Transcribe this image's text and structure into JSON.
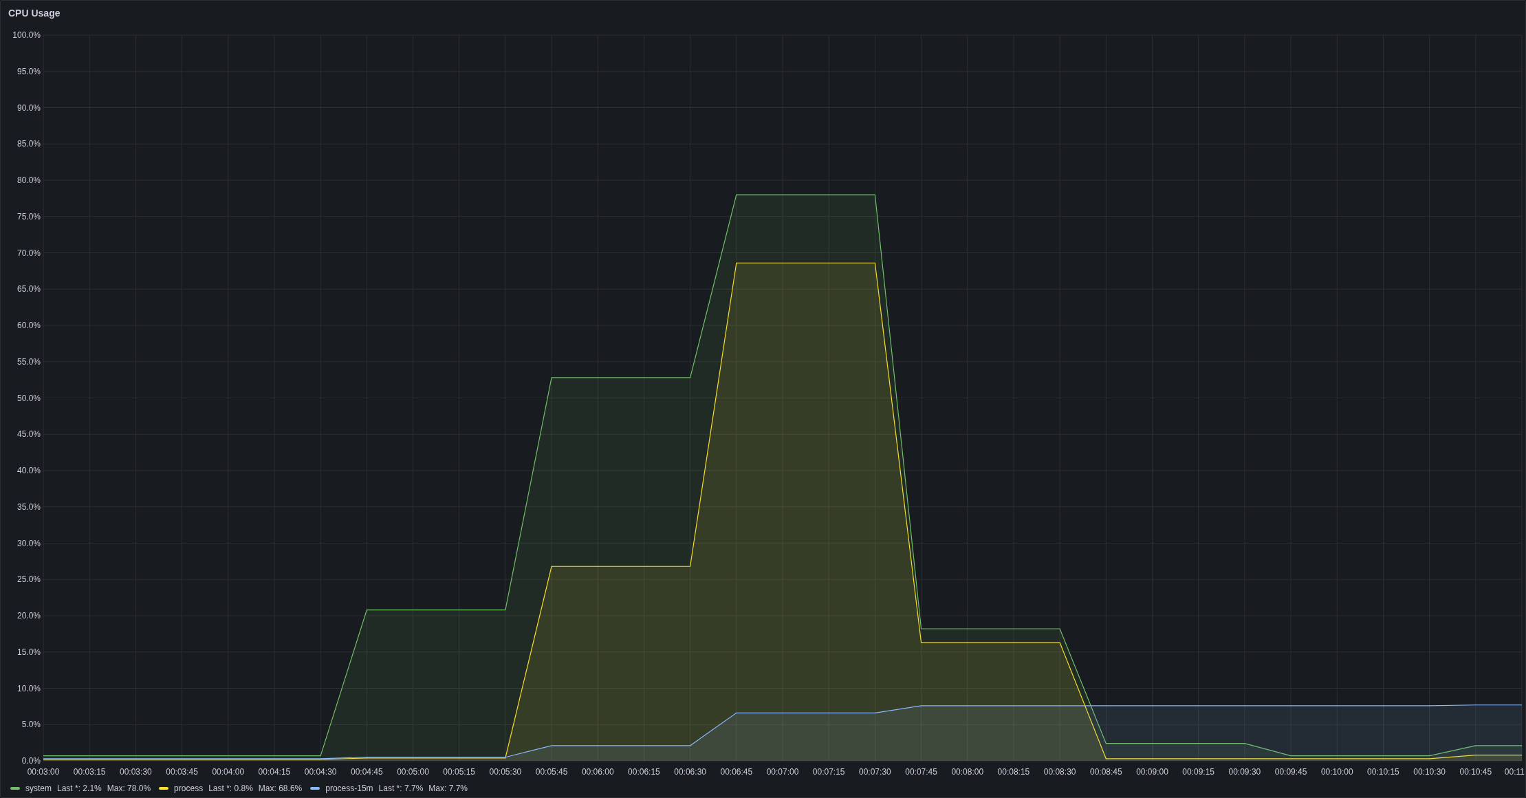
{
  "panel": {
    "title": "CPU Usage"
  },
  "chart_data": {
    "type": "area",
    "grid": true,
    "categories": [
      "00:03:00",
      "00:03:15",
      "00:03:30",
      "00:03:45",
      "00:04:00",
      "00:04:15",
      "00:04:30",
      "00:04:45",
      "00:05:00",
      "00:05:15",
      "00:05:30",
      "00:05:45",
      "00:06:00",
      "00:06:15",
      "00:06:30",
      "00:06:45",
      "00:07:00",
      "00:07:15",
      "00:07:30",
      "00:07:45",
      "00:08:00",
      "00:08:15",
      "00:08:30",
      "00:08:45",
      "00:09:00",
      "00:09:15",
      "00:09:30",
      "00:09:45",
      "00:10:00",
      "00:10:15",
      "00:10:30",
      "00:10:45",
      "00:11"
    ],
    "ylim": [
      0,
      100
    ],
    "yticks": [
      {
        "value": 0,
        "label": "0.0%"
      },
      {
        "value": 5,
        "label": "5.0%"
      },
      {
        "value": 10,
        "label": "10.0%"
      },
      {
        "value": 15,
        "label": "15.0%"
      },
      {
        "value": 20,
        "label": "20.0%"
      },
      {
        "value": 25,
        "label": "25.0%"
      },
      {
        "value": 30,
        "label": "30.0%"
      },
      {
        "value": 35,
        "label": "35.0%"
      },
      {
        "value": 40,
        "label": "40.0%"
      },
      {
        "value": 45,
        "label": "45.0%"
      },
      {
        "value": 50,
        "label": "50.0%"
      },
      {
        "value": 55,
        "label": "55.0%"
      },
      {
        "value": 60,
        "label": "60.0%"
      },
      {
        "value": 65,
        "label": "65.0%"
      },
      {
        "value": 70,
        "label": "70.0%"
      },
      {
        "value": 75,
        "label": "75.0%"
      },
      {
        "value": 80,
        "label": "80.0%"
      },
      {
        "value": 85,
        "label": "85.0%"
      },
      {
        "value": 90,
        "label": "90.0%"
      },
      {
        "value": 95,
        "label": "95.0%"
      },
      {
        "value": 100,
        "label": "100.0%"
      }
    ],
    "series": [
      {
        "name": "system",
        "color": "#73bf69",
        "values": [
          0.7,
          0.7,
          0.7,
          0.7,
          0.7,
          0.7,
          0.7,
          20.8,
          20.8,
          20.8,
          20.8,
          52.8,
          52.8,
          52.8,
          52.8,
          78.0,
          78.0,
          78.0,
          78.0,
          18.2,
          18.2,
          18.2,
          18.2,
          2.4,
          2.4,
          2.4,
          2.4,
          0.7,
          0.7,
          0.7,
          0.7,
          2.1,
          2.1
        ]
      },
      {
        "name": "process",
        "color": "#fade2a",
        "values": [
          0.2,
          0.2,
          0.2,
          0.2,
          0.2,
          0.2,
          0.2,
          0.4,
          0.4,
          0.4,
          0.4,
          26.8,
          26.8,
          26.8,
          26.8,
          68.6,
          68.6,
          68.6,
          68.6,
          16.3,
          16.3,
          16.3,
          16.3,
          0.3,
          0.3,
          0.3,
          0.3,
          0.3,
          0.3,
          0.3,
          0.3,
          0.8,
          0.8
        ]
      },
      {
        "name": "process-15m",
        "color": "#8ab8ff",
        "values": [
          0.3,
          0.3,
          0.3,
          0.3,
          0.3,
          0.3,
          0.3,
          0.5,
          0.5,
          0.5,
          0.5,
          2.1,
          2.1,
          2.1,
          2.1,
          6.6,
          6.6,
          6.6,
          6.6,
          7.6,
          7.6,
          7.6,
          7.6,
          7.6,
          7.6,
          7.6,
          7.6,
          7.6,
          7.6,
          7.6,
          7.6,
          7.7,
          7.7
        ]
      }
    ]
  },
  "legend": [
    {
      "last": "Last *: 2.1%",
      "max": "Max: 78.0%"
    },
    {
      "last": "Last *: 0.8%",
      "max": "Max: 68.6%"
    },
    {
      "last": "Last *: 7.7%",
      "max": "Max: 7.7%"
    }
  ]
}
